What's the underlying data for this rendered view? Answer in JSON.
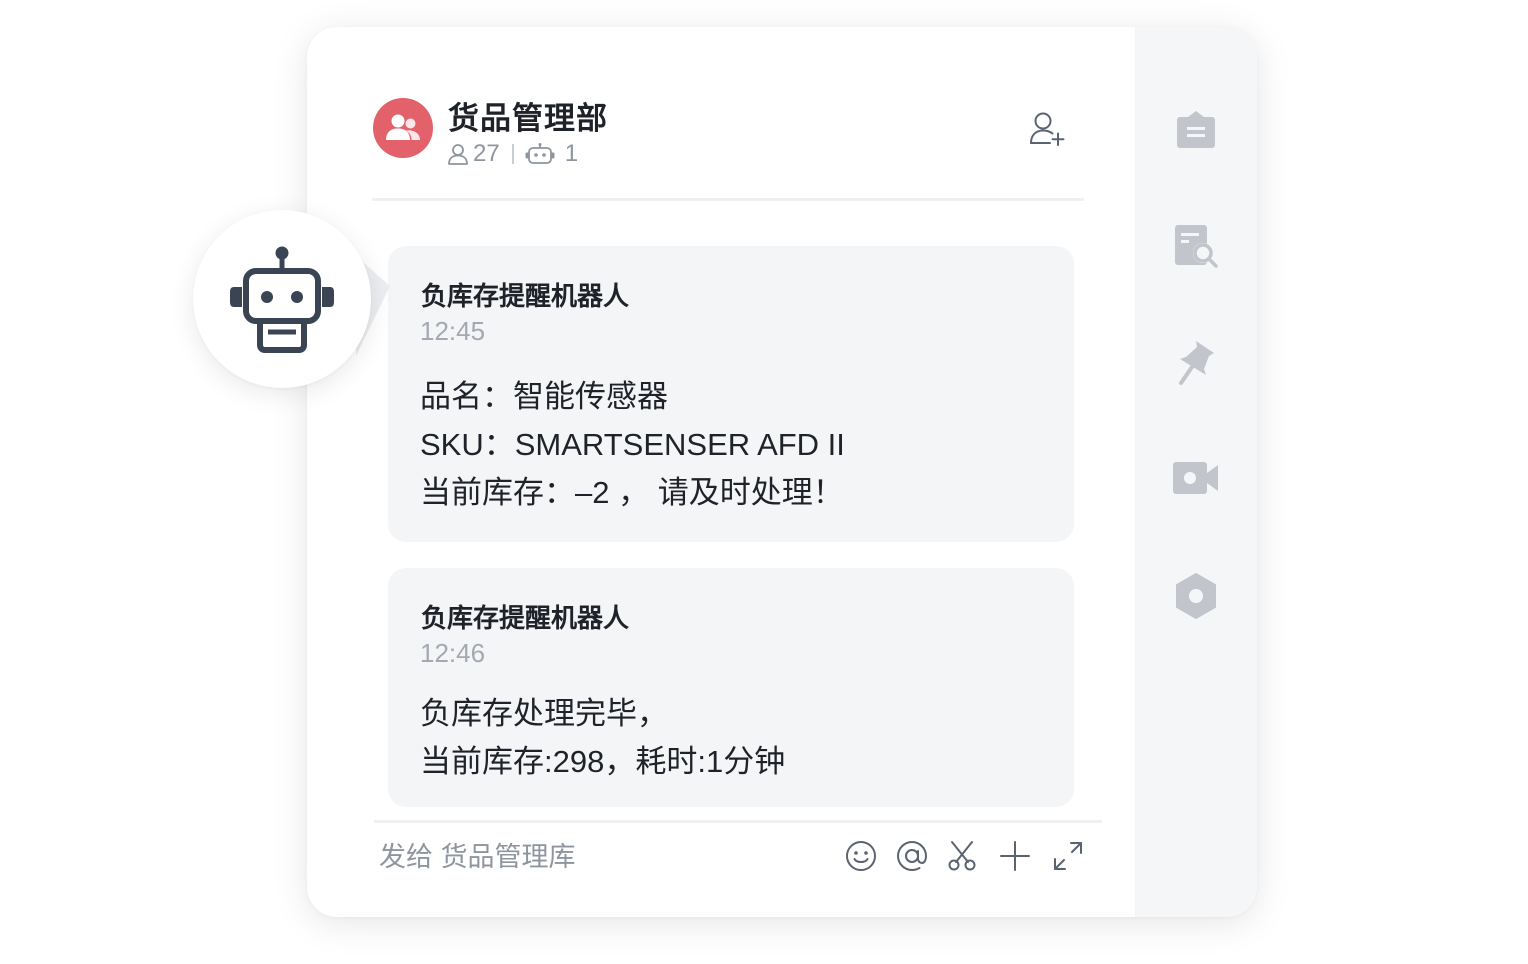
{
  "header": {
    "title": "货品管理部",
    "member_count": "27",
    "bot_count": "1",
    "avatar_icon": "group-icon",
    "avatar_color": "#e2616b",
    "add_member_icon": "add-user-icon"
  },
  "messages": [
    {
      "sender": "负库存提醒机器人",
      "time": "12:45",
      "lines": [
        "品名：智能传感器",
        "SKU：SMARTSENSER AFD II",
        "当前库存：–2 ， 请及时处理！"
      ]
    },
    {
      "sender": "负库存提醒机器人",
      "time": "12:46",
      "lines": [
        "负库存处理完毕，",
        "当前库存:298，耗时:1分钟"
      ]
    }
  ],
  "composer": {
    "placeholder": "发给 货品管理库",
    "tools": [
      "emoji-icon",
      "mention-icon",
      "scissors-icon",
      "plus-icon",
      "expand-icon"
    ]
  },
  "side_panel": {
    "icons": [
      "announcement-icon",
      "search-docs-icon",
      "pin-icon",
      "video-icon",
      "settings-icon"
    ],
    "icon_color": "#c2c6cc"
  },
  "robot_badge": {
    "icon": "robot-icon",
    "color": "#3b4453"
  }
}
